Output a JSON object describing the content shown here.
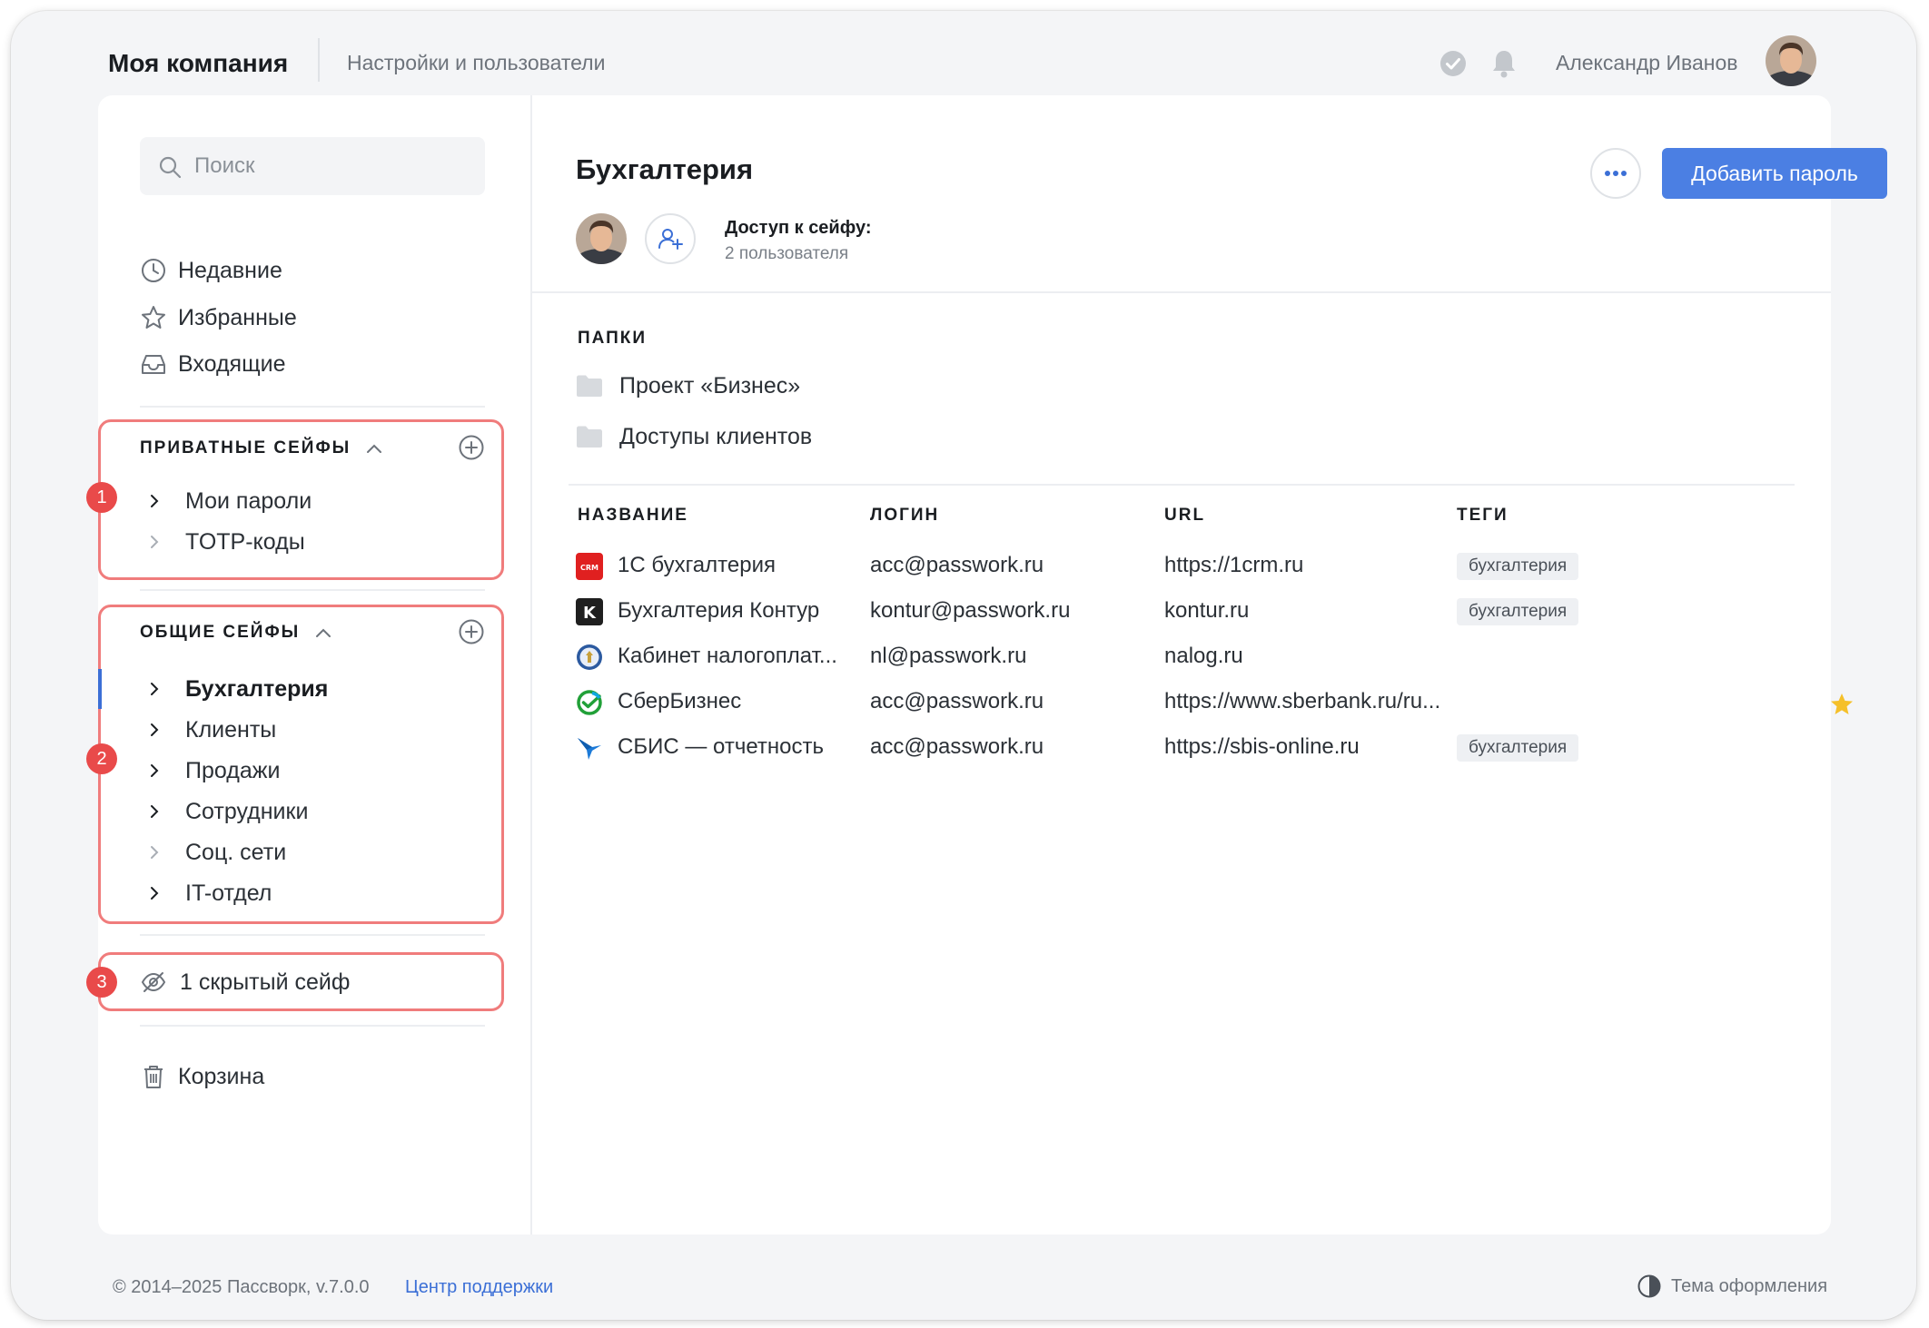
{
  "header": {
    "company": "Моя компания",
    "settings_link": "Настройки и пользователи",
    "username": "Александр Иванов"
  },
  "sidebar": {
    "search_placeholder": "Поиск",
    "nav": [
      {
        "label": "Недавние",
        "icon": "clock-icon"
      },
      {
        "label": "Избранные",
        "icon": "star-icon"
      },
      {
        "label": "Входящие",
        "icon": "inbox-icon"
      }
    ],
    "private": {
      "title": "ПРИВАТНЫЕ СЕЙФЫ",
      "marker": "1",
      "items": [
        "Мои пароли",
        "TOTP-коды"
      ]
    },
    "shared": {
      "title": "ОБЩИЕ СЕЙФЫ",
      "marker": "2",
      "items": [
        "Бухгалтерия",
        "Клиенты",
        "Продажи",
        "Сотрудники",
        "Соц. сети",
        "IT-отдел"
      ]
    },
    "hidden": {
      "label": "1 скрытый сейф",
      "marker": "3"
    },
    "trash": "Корзина"
  },
  "vault": {
    "title": "Бухгалтерия",
    "add_button": "Добавить пароль",
    "access_title": "Доступ к сейфу:",
    "access_count": "2 пользователя"
  },
  "folders": {
    "label": "ПАПКИ",
    "items": [
      "Проект «Бизнес»",
      "Доступы клиентов"
    ]
  },
  "table": {
    "columns": [
      "НАЗВАНИЕ",
      "ЛОГИН",
      "URL",
      "ТЕГИ"
    ],
    "rows": [
      {
        "name": "1С бухгалтерия",
        "login": "acc@passwork.ru",
        "url": "https://1crm.ru",
        "tag": "бухгалтерия",
        "icon": "crm-icon",
        "icon_text": "CRM"
      },
      {
        "name": "Бухгалтерия Контур",
        "login": "kontur@passwork.ru",
        "url": "kontur.ru",
        "tag": "бухгалтерия",
        "icon": "kontur-icon",
        "icon_text": "K"
      },
      {
        "name": "Кабинет налогоплат...",
        "login": "nl@passwork.ru",
        "url": "nalog.ru",
        "tag": "",
        "icon": "nalog-emblem-icon"
      },
      {
        "name": "СберБизнес",
        "login": "acc@passwork.ru",
        "url": "https://www.sberbank.ru/ru...",
        "tag": "",
        "icon": "sber-icon",
        "favorite": true
      },
      {
        "name": "СБИС — отчетность",
        "login": "acc@passwork.ru",
        "url": "https://sbis-online.ru",
        "tag": "бухгалтерия",
        "icon": "sbis-bird-icon"
      }
    ]
  },
  "footer": {
    "copyright": "© 2014–2025 Пассворк, v.7.0.0",
    "support": "Центр поддержки",
    "theme": "Тема оформления"
  },
  "colors": {
    "accent": "#4b7fe3",
    "highlight": "#f07c7c",
    "marker": "#e94a4a",
    "star": "#f5c02a"
  }
}
